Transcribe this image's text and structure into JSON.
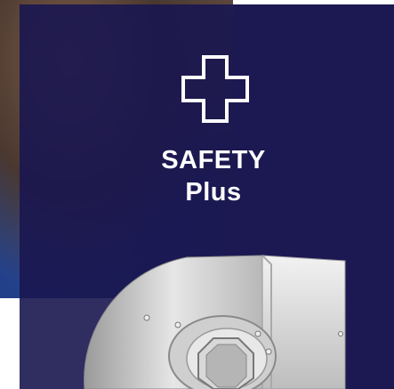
{
  "banner": {
    "title_line1": "SAFETY",
    "title_line2": "Plus",
    "icon": "plus-cross-icon",
    "background_color": "#1c1852"
  },
  "product": {
    "image": "fan-blower-housing-image"
  }
}
